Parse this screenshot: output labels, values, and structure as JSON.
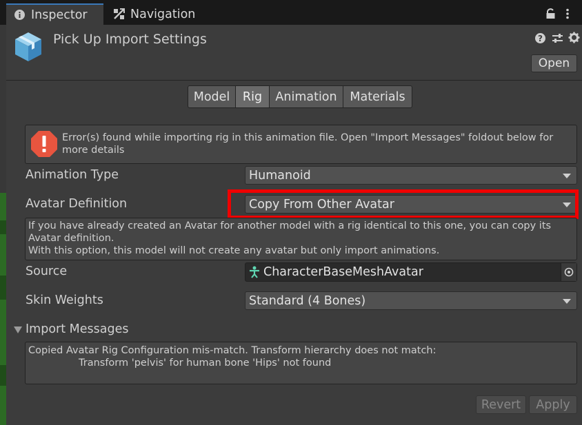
{
  "tabs": {
    "inspector": "Inspector",
    "navigation": "Navigation"
  },
  "header": {
    "title": "Pick Up Import Settings",
    "open_label": "Open"
  },
  "import_tabs": [
    "Model",
    "Rig",
    "Animation",
    "Materials"
  ],
  "active_import_tab": "Rig",
  "error_message": "Error(s) found while importing rig in this animation file. Open \"Import Messages\" foldout below for more details",
  "fields": {
    "animation_type": {
      "label": "Animation Type",
      "value": "Humanoid"
    },
    "avatar_definition": {
      "label": "Avatar Definition",
      "value": "Copy From Other Avatar"
    },
    "source": {
      "label": "Source",
      "value": "CharacterBaseMeshAvatar"
    },
    "skin_weights": {
      "label": "Skin Weights",
      "value": "Standard (4 Bones)"
    }
  },
  "info_lines": [
    "If you have already created an Avatar for another model with a rig identical to this one, you can copy its Avatar definition.",
    "With this option, this model will not create any avatar but only import animations."
  ],
  "import_messages": {
    "label": "Import Messages",
    "line1": "Copied Avatar Rig Configuration mis-match. Transform hierarchy does not match:",
    "line2": "Transform 'pelvis' for human bone 'Hips' not found"
  },
  "buttons": {
    "revert": "Revert",
    "apply": "Apply"
  },
  "colors": {
    "accent": "#3a79bb",
    "highlight": "#ef0000",
    "error": "#e8553f",
    "avatar_icon": "#5fd6b2"
  }
}
